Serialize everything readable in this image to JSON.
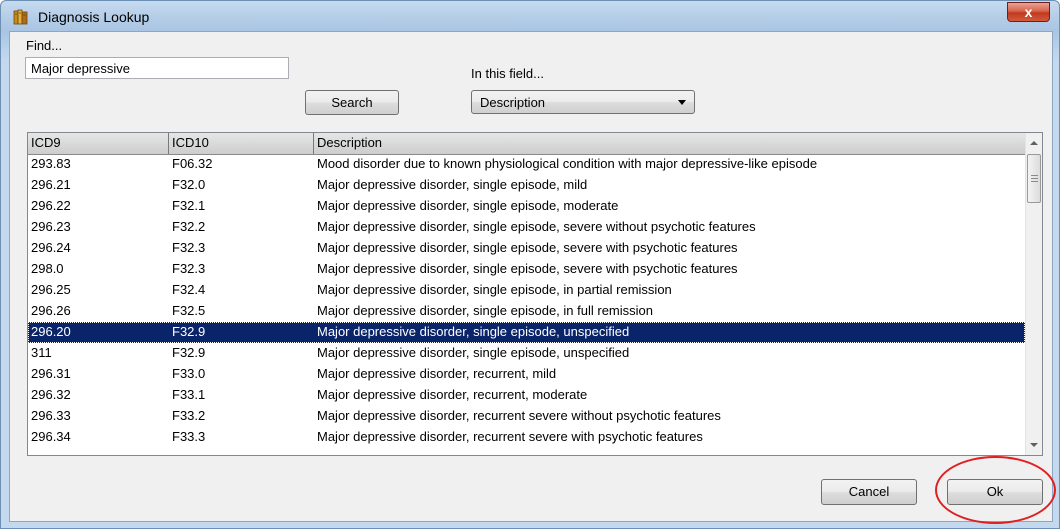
{
  "window": {
    "title": "Diagnosis Lookup",
    "close_label": "x"
  },
  "form": {
    "find_label": "Find...",
    "find_value": "Major depressive",
    "search_label": "Search",
    "field_label": "In this field...",
    "field_value": "Description"
  },
  "table": {
    "columns": [
      "ICD9",
      "ICD10",
      "Description"
    ],
    "selected_index": 8,
    "rows": [
      [
        "293.83",
        "F06.32",
        "Mood disorder due to known physiological condition with major depressive-like episode"
      ],
      [
        "296.21",
        "F32.0",
        "Major depressive disorder, single episode, mild"
      ],
      [
        "296.22",
        "F32.1",
        "Major depressive disorder, single episode, moderate"
      ],
      [
        "296.23",
        "F32.2",
        "Major depressive disorder, single episode, severe without psychotic features"
      ],
      [
        "296.24",
        "F32.3",
        "Major depressive disorder, single episode, severe with psychotic features"
      ],
      [
        "298.0",
        "F32.3",
        "Major depressive disorder, single episode, severe with psychotic features"
      ],
      [
        "296.25",
        "F32.4",
        "Major depressive disorder, single episode, in partial remission"
      ],
      [
        "296.26",
        "F32.5",
        "Major depressive disorder, single episode, in full remission"
      ],
      [
        "296.20",
        "F32.9",
        "Major depressive disorder, single episode, unspecified"
      ],
      [
        "311",
        "F32.9",
        "Major depressive disorder, single episode, unspecified"
      ],
      [
        "296.31",
        "F33.0",
        "Major depressive disorder, recurrent, mild"
      ],
      [
        "296.32",
        "F33.1",
        "Major depressive disorder, recurrent, moderate"
      ],
      [
        "296.33",
        "F33.2",
        "Major depressive disorder, recurrent severe without psychotic features"
      ],
      [
        "296.34",
        "F33.3",
        "Major depressive disorder, recurrent severe with psychotic features"
      ]
    ]
  },
  "buttons": {
    "cancel_label": "Cancel",
    "ok_label": "Ok"
  },
  "colors": {
    "selection": "#0a246a",
    "annotation": "#e02020"
  },
  "icons": {
    "app": "books-icon",
    "close": "close-icon"
  }
}
